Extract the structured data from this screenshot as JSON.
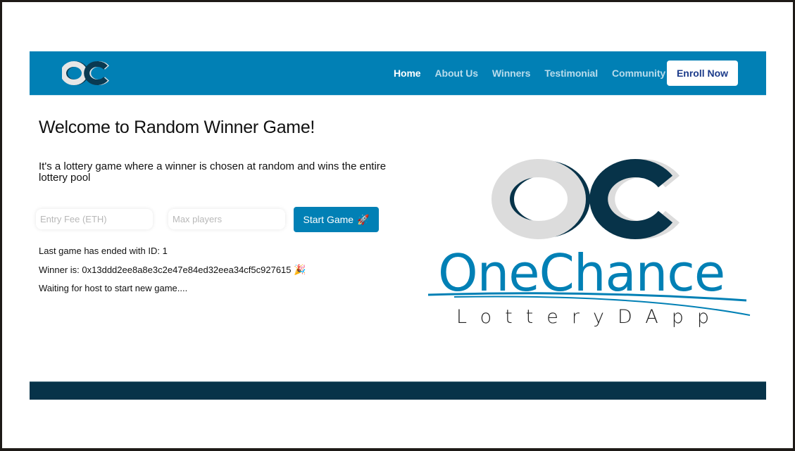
{
  "header": {
    "logo_text": "OC",
    "nav": [
      {
        "label": "Home",
        "active": true
      },
      {
        "label": "About Us",
        "active": false
      },
      {
        "label": "Winners",
        "active": false
      },
      {
        "label": "Testimonial",
        "active": false
      },
      {
        "label": "Community",
        "active": false
      }
    ],
    "enroll_label": "Enroll Now"
  },
  "main": {
    "title": "Welcome to Random Winner Game!",
    "description": "It's a lottery game where a winner is chosen at random and wins the entire lottery pool",
    "entry_fee": {
      "value": "",
      "placeholder": "Entry Fee (ETH)"
    },
    "max_players": {
      "value": "",
      "placeholder": "Max players"
    },
    "start_button": {
      "label": "Start Game",
      "icon": "rocket-icon",
      "glyph": "🚀"
    },
    "status": {
      "last_game": "Last game has ended with ID: 1",
      "winner": "Winner is: 0x13ddd2ee8a8e3c2e47e84ed32eea34cf5c927615",
      "winner_icon": "🎉",
      "waiting": "Waiting for host to start new game...."
    }
  },
  "brand": {
    "monogram": "OC",
    "name": "OneChance",
    "tagline": "LotteryDApp"
  },
  "colors": {
    "primary": "#0180b5",
    "dark": "#073349",
    "light_gray": "#dcdcdc",
    "enroll_text": "#1c3b8a"
  }
}
